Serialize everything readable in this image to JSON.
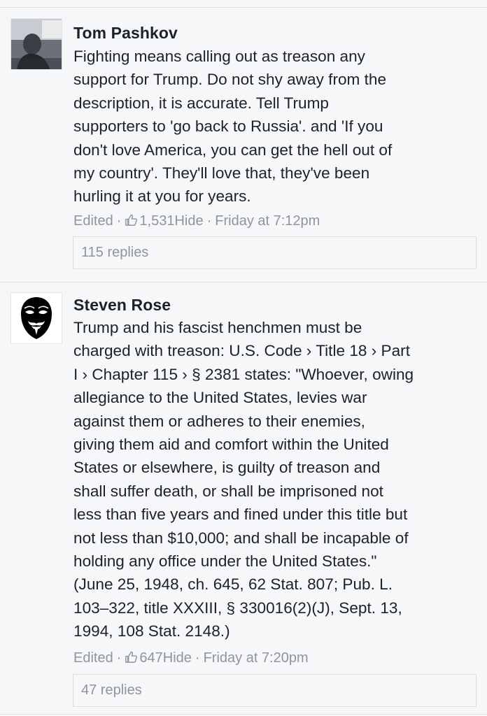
{
  "comments": [
    {
      "author": "Tom Pashkov",
      "lines": [
        "Fighting means calling out as treason any",
        "support for Trump. Do not shy away from the",
        "description, it is accurate. Tell Trump",
        "supporters to 'go back to Russia'. and 'If you",
        "don't love America, you can get the hell out of",
        "my country'. They'll love that, they've been",
        "hurling it at you for years."
      ],
      "edited": "Edited",
      "likes": "1,531",
      "hide": "Hide",
      "timestamp": "Friday at 7:12pm",
      "replies": "115 replies"
    },
    {
      "author": "Steven Rose",
      "lines": [
        "Trump and his fascist henchmen must be",
        "charged with treason: U.S. Code › Title 18 › Part",
        "I › Chapter 115 › § 2381 states: \"Whoever, owing",
        "allegiance to the United States, levies war",
        "against them or adheres to their enemies,",
        "giving them aid and comfort within the United",
        "States or elsewhere, is guilty of treason and",
        "shall suffer death, or shall be imprisoned not",
        "less than five years and fined under this title but",
        "not less than $10,000; and shall be incapable of",
        "holding any office under the United States.\"",
        "(June 25, 1948, ch. 645, 62 Stat. 807; Pub. L.",
        "103–322, title XXXIII, § 330016(2)(J), Sept. 13,",
        "1994, 108 Stat. 2148.)"
      ],
      "edited": "Edited",
      "likes": "647",
      "hide": "Hide",
      "timestamp": "Friday at 7:20pm",
      "replies": "47 replies"
    }
  ],
  "icons": {
    "like": "thumbs-up-icon",
    "avatar_1": "user-photo",
    "avatar_2": "guy-fawkes-mask-icon"
  },
  "colors": {
    "text": "#1d2129",
    "meta": "#90949c",
    "border": "#dddfe2",
    "background": "#f6f7f9"
  }
}
